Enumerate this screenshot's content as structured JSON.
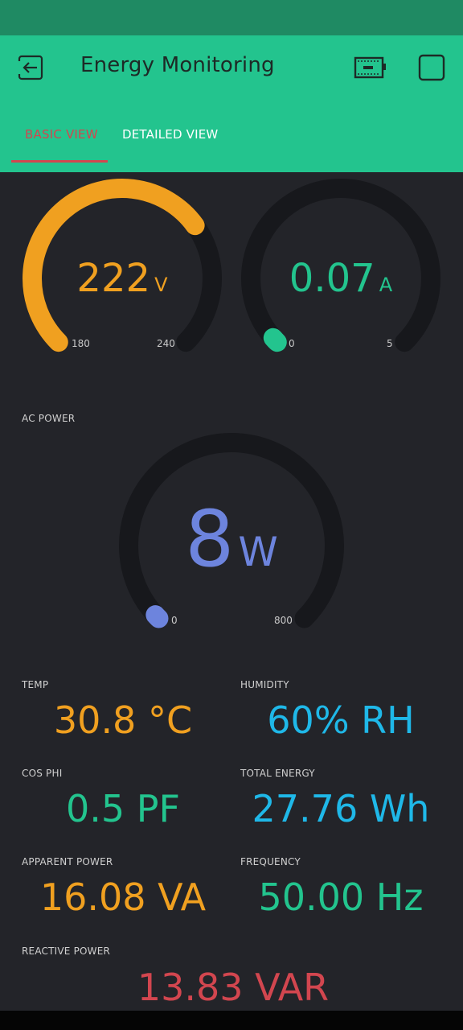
{
  "app": {
    "title": "Energy Monitoring",
    "tabs": [
      {
        "label": "BASIC VIEW",
        "active": true
      },
      {
        "label": "DETAILED VIEW",
        "active": false
      }
    ],
    "icons": [
      "exit-icon",
      "battery-icon",
      "square-icon"
    ]
  },
  "colors": {
    "header": "#23c48e",
    "status_bar": "#1f8a63",
    "background": "#232429",
    "orange": "#f0a020",
    "green": "#23c48e",
    "blue": "#6d84dd",
    "cyan": "#1fb8e8",
    "red": "#d2464f",
    "track": "#17181c"
  },
  "gauges": {
    "voltage": {
      "value": "222",
      "unit": "V",
      "min": "180",
      "max": "240",
      "level": 0.7
    },
    "current": {
      "value": "0.07",
      "unit": "A",
      "min": "0",
      "max": "5",
      "level": 0.014
    },
    "power": {
      "label": "AC POWER",
      "value": "8",
      "unit": "W",
      "min": "0",
      "max": "800",
      "level": 0.01
    }
  },
  "readings": {
    "temp": {
      "label": "TEMP",
      "value": "30.8 °C"
    },
    "humidity": {
      "label": "HUMIDITY",
      "value": "60% RH"
    },
    "cos_phi": {
      "label": "COS PHI",
      "value": "0.5 PF"
    },
    "total_energy": {
      "label": "TOTAL ENERGY",
      "value": "27.76 Wh"
    },
    "apparent_power": {
      "label": "APPARENT POWER",
      "value": "16.08 VA"
    },
    "frequency": {
      "label": "FREQUENCY",
      "value": "50.00 Hz"
    },
    "reactive_power": {
      "label": "REACTIVE POWER",
      "value": "13.83 VAR"
    }
  }
}
